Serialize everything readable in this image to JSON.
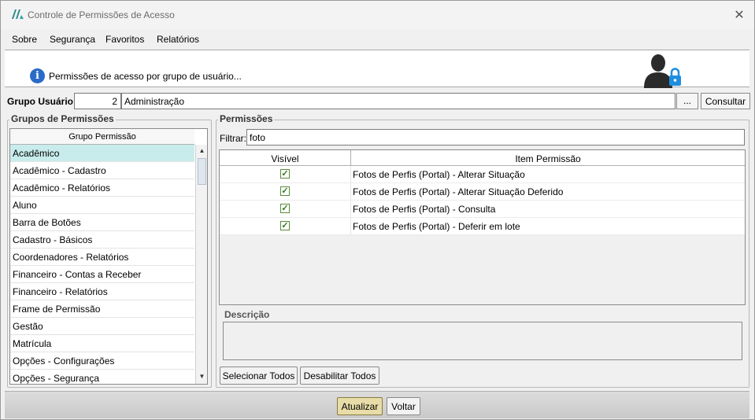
{
  "window": {
    "title": "Controle de Permissões de Acesso",
    "close_glyph": "✕"
  },
  "menu": [
    "Sobre",
    "Segurança",
    "Favoritos",
    "Relatórios"
  ],
  "banner": {
    "text": "Permissões de acesso por grupo de usuário..."
  },
  "group": {
    "label": "Grupo Usuário:",
    "id": "2",
    "name": "Administração",
    "dots_label": "...",
    "consult_label": "Consultar"
  },
  "left_panel": {
    "title": "Grupos de Permissões",
    "column_header": "Grupo Permissão",
    "items": [
      "Acadêmico",
      "Acadêmico - Cadastro",
      "Acadêmico - Relatórios",
      "Aluno",
      "Barra de Botões",
      "Cadastro - Básicos",
      "Coordenadores - Relatórios",
      "Financeiro - Contas a Receber",
      "Financeiro - Relatórios",
      "Frame de Permissão",
      "Gestão",
      "Matrícula",
      "Opções - Configurações",
      "Opções - Segurança"
    ],
    "selected_index": 0
  },
  "right_panel": {
    "title": "Permissões",
    "filter_label": "Filtrar:",
    "filter_value": "foto",
    "columns": {
      "visible": "Visível",
      "item": "Item Permissão"
    },
    "rows": [
      {
        "visible": true,
        "item": "Fotos de Perfis (Portal) - Alterar Situação"
      },
      {
        "visible": true,
        "item": "Fotos de Perfis (Portal) - Alterar Situação Deferido"
      },
      {
        "visible": true,
        "item": "Fotos de Perfis (Portal) - Consulta"
      },
      {
        "visible": true,
        "item": "Fotos de Perfis (Portal) - Deferir em lote"
      }
    ],
    "description_label": "Descrição",
    "select_all_label": "Selecionar Todos",
    "disable_all_label": "Desabilitar Todos"
  },
  "footer": {
    "update_label": "Atualizar",
    "back_label": "Voltar"
  },
  "colors": {
    "selected_row": "#c8ecec",
    "info_blue": "#2a6bc8",
    "check_green": "#2f7a1e",
    "update_btn": "#e8dca8"
  }
}
